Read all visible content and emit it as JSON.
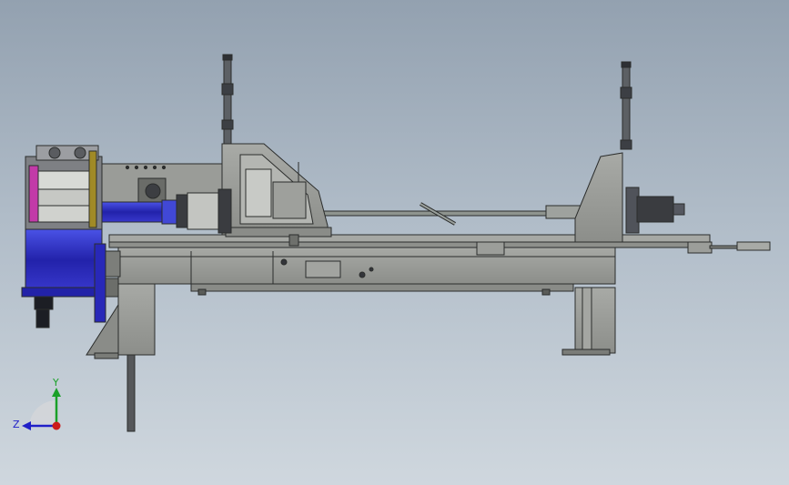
{
  "colors": {
    "frame": "#9a9c98",
    "frame_dark": "#6e706c",
    "edge": "#2b2d2c",
    "blue": "#2323b4",
    "blue_light": "#3a42d8",
    "magenta": "#c23aa8",
    "gold": "#a08a26",
    "rod": "#8d948f",
    "axis_y": "#1aa028",
    "axis_z": "#2020c8",
    "axis_origin": "#cc1a1a"
  },
  "triad": {
    "y_label": "Y",
    "z_label": "Z"
  }
}
